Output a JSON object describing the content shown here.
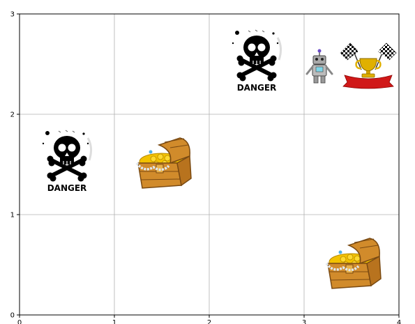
{
  "grid": {
    "x_range": [
      0,
      4
    ],
    "y_range": [
      0,
      3
    ],
    "x_ticks": [
      "0",
      "1",
      "2",
      "3",
      "4"
    ],
    "y_ticks": [
      "0",
      "1",
      "2",
      "3"
    ],
    "gridlines": true
  },
  "board": {
    "cells": [
      {
        "item": "danger-skull",
        "col": 0,
        "row": 1,
        "label": "DANGER"
      },
      {
        "item": "treasure-chest",
        "col": 1,
        "row": 1
      },
      {
        "item": "danger-skull",
        "col": 2,
        "row": 2,
        "label": "DANGER"
      },
      {
        "item": "robot",
        "col": 3,
        "row": 2
      },
      {
        "item": "trophy-flags",
        "col": 3,
        "row": 2
      },
      {
        "item": "treasure-chest",
        "col": 3,
        "row": 0
      }
    ]
  },
  "colors": {
    "grid": "#b0b0b0",
    "axis": "#000000",
    "chest_wood": "#d18b2b",
    "gold": "#f2c200",
    "trophy": "#e0b000",
    "ribbon": "#d01818"
  }
}
